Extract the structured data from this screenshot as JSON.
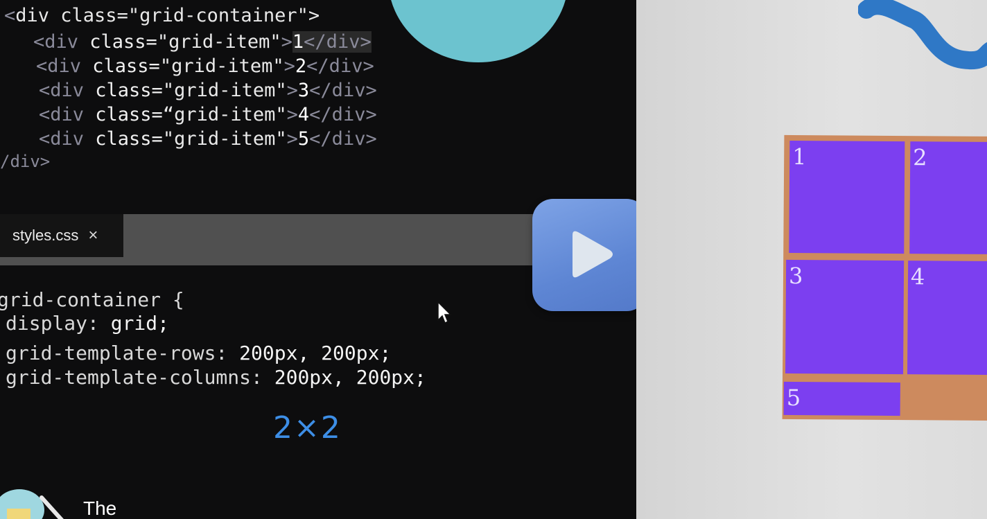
{
  "editor": {
    "html_code": {
      "open": "div class=\"grid-container\">",
      "items": [
        {
          "tag_open": "<div ",
          "attr": "class=",
          "value": "\"grid-item\"",
          "gt": ">",
          "text": "1",
          "close": "</div>"
        },
        {
          "tag_open": "<div ",
          "attr": "class=",
          "value": "\"grid-item\"",
          "gt": ">",
          "text": "2",
          "close": "</div>"
        },
        {
          "tag_open": "<div ",
          "attr": "class=",
          "value": "\"grid-item\"",
          "gt": ">",
          "text": "3",
          "close": "</div>"
        },
        {
          "tag_open": "<div ",
          "attr": "class=",
          "value": "“grid-item\"",
          "gt": ">",
          "text": "4",
          "close": "</div>"
        },
        {
          "tag_open": "<div ",
          "attr": "class=",
          "value": "\"grid-item\"",
          "gt": ">",
          "text": "5",
          "close": "</div>"
        }
      ],
      "close": "/div>"
    },
    "tab": {
      "filename": "styles.css",
      "close_icon": "×"
    },
    "css_code": {
      "selector": "grid-container {",
      "lines": [
        {
          "prop": "display: ",
          "val": "grid;"
        },
        {
          "prop": "grid-template-rows: ",
          "val": "200px, 200px;"
        },
        {
          "prop": "grid-template-columns: ",
          "val": "200px, 200px;"
        }
      ]
    },
    "annotation": "2×2",
    "subtitle": "The"
  },
  "play_button": {
    "icon": "play-icon"
  },
  "preview": {
    "cells": [
      "1",
      "2",
      "3",
      "4",
      "5"
    ],
    "colors": {
      "cell": "#7c3ff0",
      "gap": "#cd8a5e"
    }
  },
  "colors": {
    "editor_bg": "#0d0d0e",
    "tab_bar": "#505050",
    "play_button": "#6a8fdb",
    "annotation": "#3d8ee6",
    "decor_blob": "#6cc3cf",
    "decor_squiggle": "#2f78c6"
  }
}
